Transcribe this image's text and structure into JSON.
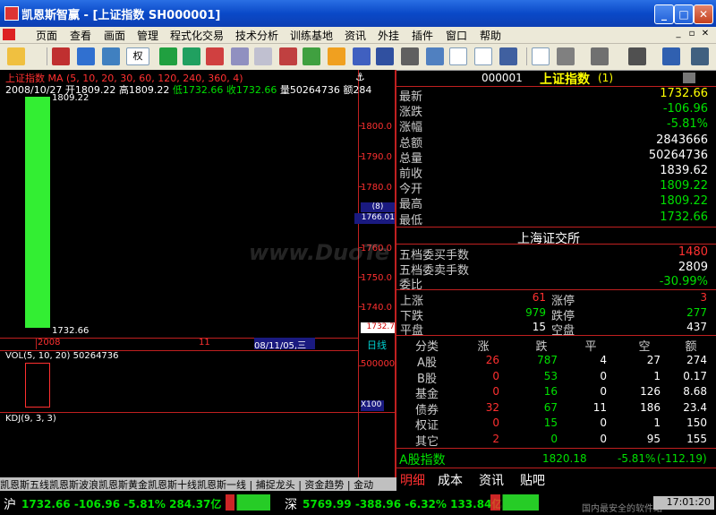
{
  "window": {
    "title": "凯恩斯智赢 - [上证指数  SH000001]"
  },
  "menu": [
    "页面",
    "查看",
    "画面",
    "管理",
    "程式化交易",
    "技术分析",
    "训练基地",
    "资讯",
    "外挂",
    "插件",
    "窗口",
    "帮助"
  ],
  "toolbar": {
    "quan_label": "权"
  },
  "chart": {
    "indicator_line": "上证指数  MA (5, 10, 20, 30, 60, 120, 240, 360, 4)",
    "info": {
      "date": "2008/10/27",
      "open": "开1809.22",
      "high": "高1809.22",
      "low": "低1732.66",
      "close": "收1732.66",
      "vol": "量50264736",
      "amt": "额284"
    },
    "high_label": "1809.22",
    "low_label": "1732.66",
    "y_ticks": [
      "1800.0",
      "1790.0",
      "1780.0",
      "1760.0",
      "1750.0",
      "1740.0"
    ],
    "crosshair_tag": "(8)",
    "crosshair_value": "1766.01",
    "last_price_tag": "1732.7",
    "date_left": "2008",
    "date_mid": "11",
    "cursor_date": "08/11/05,三",
    "period": "日线"
  },
  "vol_panel": {
    "label": "VOL(5, 10, 20)  50264736",
    "tick_top": "500000",
    "tick_unit": "X100"
  },
  "kdj_panel": {
    "label": "KDJ(9, 3, 3)"
  },
  "watermark": "www.DuoTe",
  "quote": {
    "code": "000001",
    "name": "上证指数",
    "suffix": "(1)",
    "rows": [
      {
        "k": "最新",
        "v": "1732.66",
        "c": "yellow"
      },
      {
        "k": "涨跌",
        "v": "-106.96",
        "c": "green"
      },
      {
        "k": "涨幅",
        "v": "-5.81%",
        "c": "green"
      },
      {
        "k": "总额",
        "v": "2843666",
        "c": "white"
      },
      {
        "k": "总量",
        "v": "50264736",
        "c": "white"
      },
      {
        "k": "前收",
        "v": "1839.62",
        "c": "white"
      },
      {
        "k": "今开",
        "v": "1809.22",
        "c": "green"
      },
      {
        "k": "最高",
        "v": "1809.22",
        "c": "green"
      },
      {
        "k": "最低",
        "v": "1732.66",
        "c": "green"
      }
    ],
    "exchange": "上海证交所",
    "orders": [
      {
        "k": "五档委买手数",
        "v": "1480",
        "c": "red"
      },
      {
        "k": "五档委卖手数",
        "v": "2809",
        "c": "white"
      },
      {
        "k": "委比",
        "v": "-30.99%",
        "c": "green"
      }
    ],
    "breadth": [
      {
        "k1": "上涨",
        "v1": "61",
        "c1": "red",
        "k2": "涨停",
        "v2": "3",
        "c2": "red"
      },
      {
        "k1": "下跌",
        "v1": "979",
        "c1": "green",
        "k2": "跌停",
        "v2": "277",
        "c2": "green"
      },
      {
        "k1": "平盘",
        "v1": "15",
        "c1": "white",
        "k2": "空盘",
        "v2": "437",
        "c2": "white"
      }
    ],
    "cat_headers": [
      "分类",
      "涨",
      "跌",
      "平",
      "空",
      "额"
    ],
    "cats": [
      {
        "n": "A股",
        "u": "26",
        "d": "787",
        "f": "4",
        "e": "27",
        "a": "274"
      },
      {
        "n": "B股",
        "u": "0",
        "d": "53",
        "f": "0",
        "e": "1",
        "a": "0.17"
      },
      {
        "n": "基金",
        "u": "0",
        "d": "16",
        "f": "0",
        "e": "126",
        "a": "8.68"
      },
      {
        "n": "债券",
        "u": "32",
        "d": "67",
        "f": "11",
        "e": "186",
        "a": "23.4"
      },
      {
        "n": "权证",
        "u": "0",
        "d": "15",
        "f": "0",
        "e": "1",
        "a": "150"
      },
      {
        "n": "其它",
        "u": "2",
        "d": "0",
        "f": "0",
        "e": "95",
        "a": "155"
      }
    ],
    "ashare_label": "A股指数",
    "ashare_value": "1820.18",
    "ashare_change": "-5.81%",
    "ashare_extra": "(-112.19)",
    "bottom_tabs": [
      "明细",
      "成本",
      "资讯",
      "贴吧"
    ]
  },
  "bottom_tabs_left": [
    "凯恩斯五线",
    "凯恩斯波浪",
    "凯恩斯黄金",
    "凯恩斯十线",
    "凯恩斯一线",
    "捕捉龙头",
    "资金趋势",
    "金动"
  ],
  "status": {
    "sh_label": "沪",
    "sh_text": "1732.66 -106.96 -5.81% 284.37亿",
    "sz_label": "深",
    "sz_text": "5769.99 -388.96 -6.32% 133.84亿",
    "time": "17:01:20",
    "watermark_text": "国内最安全的软件站"
  }
}
